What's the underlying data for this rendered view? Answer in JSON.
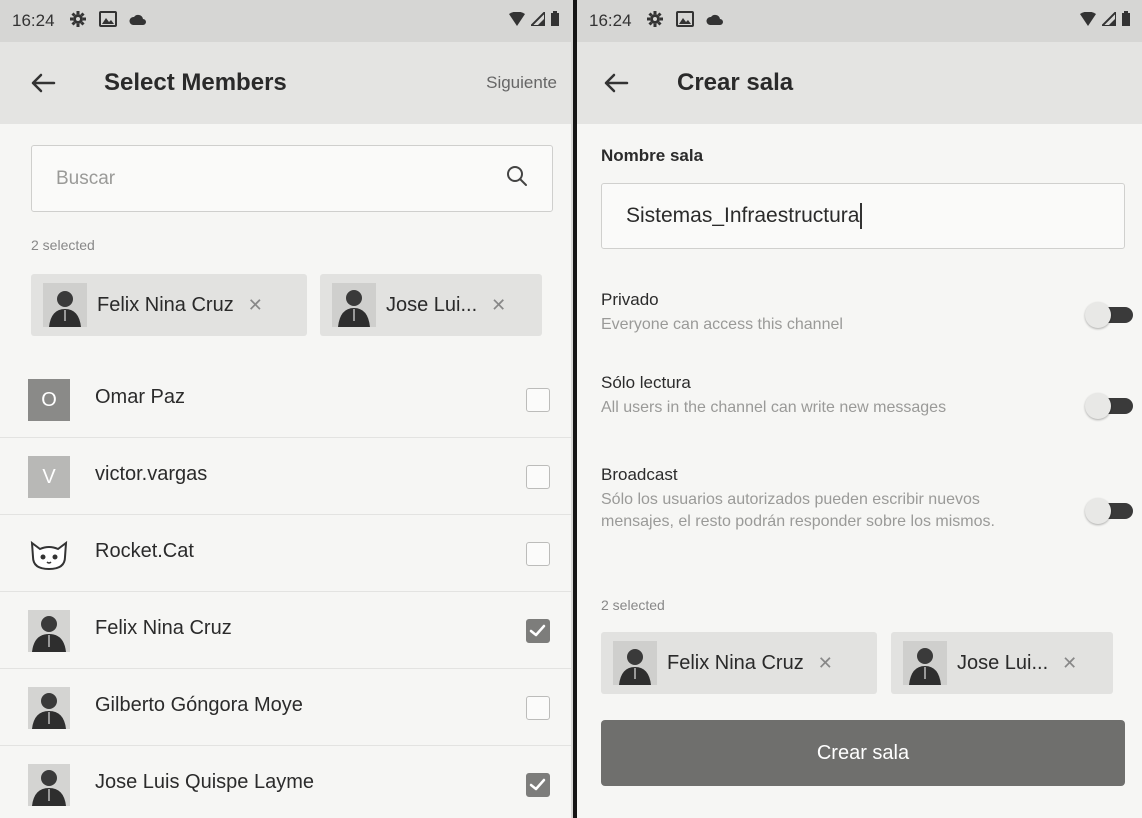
{
  "left": {
    "status": {
      "time": "16:24"
    },
    "header": {
      "title": "Select Members",
      "action_label": "Siguiente"
    },
    "search": {
      "placeholder": "Buscar"
    },
    "selected_count": "2 selected",
    "chips": [
      {
        "name": "Felix Nina Cruz"
      },
      {
        "name": "Jose Lui..."
      }
    ],
    "members": [
      {
        "name": "Omar Paz",
        "initial": "O",
        "avatar_type": "letter",
        "avatar_color": "#8a8a88",
        "checked": false
      },
      {
        "name": "victor.vargas",
        "initial": "V",
        "avatar_type": "letter",
        "avatar_color": "#b8b8b6",
        "checked": false
      },
      {
        "name": "Rocket.Cat",
        "initial": "",
        "avatar_type": "cat",
        "avatar_color": "#ffffff",
        "checked": false
      },
      {
        "name": "Felix Nina Cruz",
        "initial": "",
        "avatar_type": "photo",
        "avatar_color": "#555555",
        "checked": true
      },
      {
        "name": "Gilberto Góngora Moye",
        "initial": "",
        "avatar_type": "photo",
        "avatar_color": "#555555",
        "checked": false
      },
      {
        "name": "Jose Luis Quispe Layme",
        "initial": "",
        "avatar_type": "photo",
        "avatar_color": "#555555",
        "checked": true
      }
    ]
  },
  "right": {
    "status": {
      "time": "16:24"
    },
    "header": {
      "title": "Crear sala"
    },
    "room_name": {
      "label": "Nombre sala",
      "value": "Sistemas_Infraestructura"
    },
    "options": [
      {
        "title": "Privado",
        "description": "Everyone can access this channel",
        "enabled": true
      },
      {
        "title": "Sólo lectura",
        "description": "All users in the channel can write new messages",
        "enabled": true
      },
      {
        "title": "Broadcast",
        "description": "Sólo los usuarios autorizados pueden escribir nuevos mensajes, el resto podrán responder sobre los mismos.",
        "enabled": true
      }
    ],
    "selected_count": "2 selected",
    "chips": [
      {
        "name": "Felix Nina Cruz"
      },
      {
        "name": "Jose Lui..."
      }
    ],
    "create_button": "Crear sala"
  },
  "icons": {
    "gear": "gear-icon",
    "image": "image-icon",
    "cloud": "cloud-icon",
    "wifi": "wifi-icon",
    "signal": "signal-icon",
    "battery": "battery-icon",
    "back": "back-arrow-icon",
    "search": "search-icon",
    "close": "close-icon",
    "check": "check-icon"
  },
  "colors": {
    "status_bar": "#d6d6d4",
    "app_bar": "#e4e4e2",
    "background": "#f6f6f4",
    "button": "#6f6f6d",
    "checkbox_checked": "#7d7d7b"
  }
}
